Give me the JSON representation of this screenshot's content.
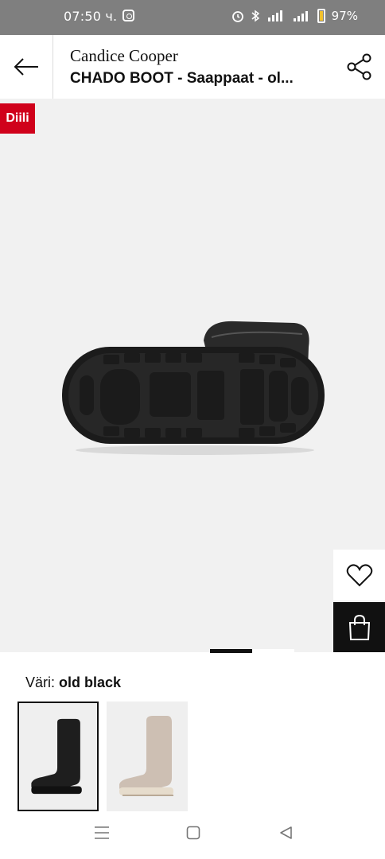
{
  "status_bar": {
    "time": "07:50 ч.",
    "indicators": [
      "alarm-icon",
      "bluetooth-icon",
      "4g-signal-icon",
      "signal-icon"
    ],
    "battery": "97%"
  },
  "header": {
    "brand": "Candice Cooper",
    "title": "CHADO BOOT - Saappaat - ol..."
  },
  "product_image": {
    "badge": "Diili",
    "gallery_position": 1,
    "gallery_count": 2
  },
  "color": {
    "label": "Väri:",
    "value": "old black",
    "options": [
      "old black",
      "beige"
    ]
  },
  "colors": {
    "badge": "#d0011b",
    "image_bg": "#f1f1f1",
    "bag_button": "#111111"
  }
}
